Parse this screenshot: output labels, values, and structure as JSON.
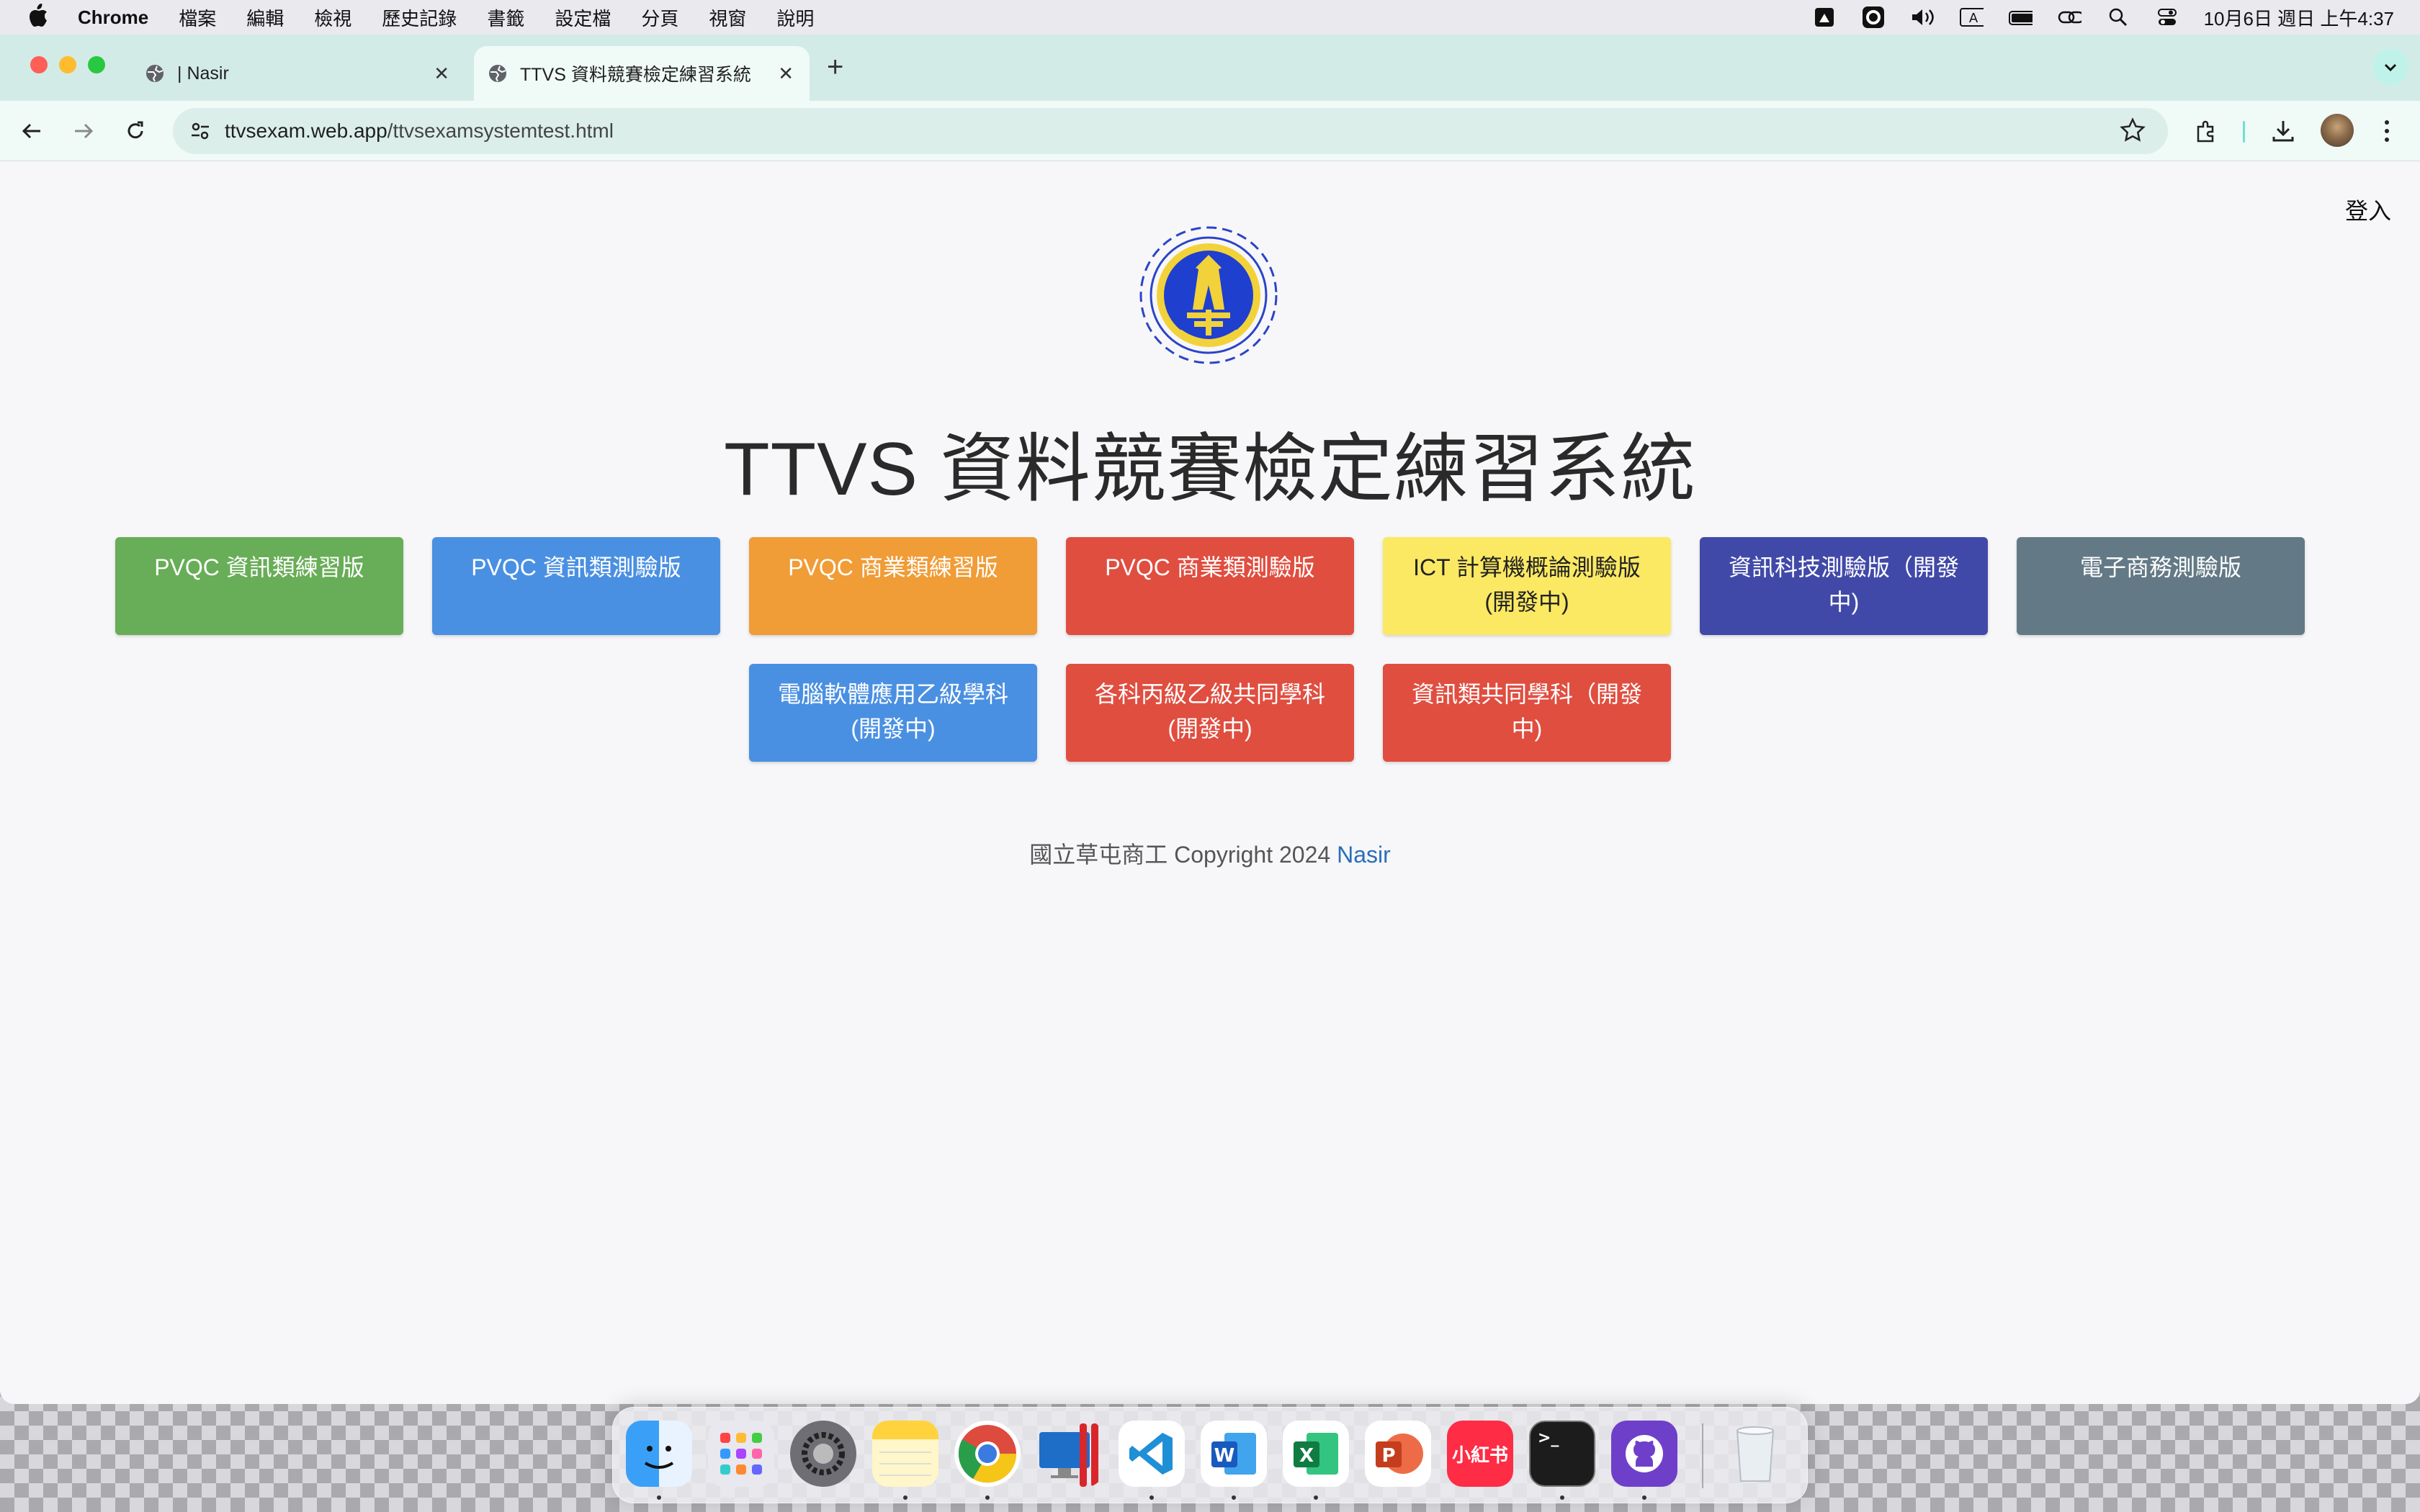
{
  "menubar": {
    "app_name": "Chrome",
    "menus": [
      "檔案",
      "編輯",
      "檢視",
      "歷史記錄",
      "書籤",
      "設定檔",
      "分頁",
      "視窗",
      "說明"
    ],
    "input_indicator": "A",
    "clock": "10月6日 週日 上午4:37"
  },
  "tabs": [
    {
      "title": "| Nasir",
      "active": false
    },
    {
      "title": "TTVS 資料競賽檢定練習系統",
      "active": true
    }
  ],
  "new_tab_label": "+",
  "address_bar": {
    "domain": "ttvsexam.web.app",
    "path": "/ttvsexamsystemtest.html"
  },
  "page": {
    "login_label": "登入",
    "title": "TTVS 資料競賽檢定練習系統",
    "buttons": [
      {
        "label": "PVQC 資訊類練習版",
        "color": "#68ad57"
      },
      {
        "label": "PVQC 資訊類測驗版",
        "color": "#4a90e2"
      },
      {
        "label": "PVQC 商業類練習版",
        "color": "#f09c37"
      },
      {
        "label": "PVQC 商業類測驗版",
        "color": "#e04e40"
      },
      {
        "label": "ICT 計算機概論測驗版(開發中)",
        "color": "#fbe963"
      },
      {
        "label": "資訊科技測驗版（開發中)",
        "color": "#4149a8"
      },
      {
        "label": "電子商務測驗版",
        "color": "#637986"
      },
      {
        "label": "電腦軟體應用乙級學科(開發中)",
        "color": "#4a90e2"
      },
      {
        "label": "各科丙級乙級共同學科(開發中)",
        "color": "#e04e40"
      },
      {
        "label": "資訊類共同學科（開發中)",
        "color": "#e04e40"
      }
    ],
    "footer_text": "國立草屯商工 Copyright 2024",
    "footer_author": "Nasir"
  },
  "dock": {
    "apps": [
      "finder-icon",
      "launchpad-icon",
      "system-settings-icon",
      "notes-icon",
      "chrome-icon",
      "parallels-icon",
      "vscode-icon",
      "word-icon",
      "excel-icon",
      "powerpoint-icon",
      "xiaohongshu-icon",
      "terminal-icon",
      "github-desktop-icon",
      "trash-icon"
    ],
    "xiaohongshu_label": "小紅书",
    "word_letter": "W",
    "excel_letter": "X",
    "powerpoint_letter": "P",
    "terminal_prompt": ">_"
  }
}
